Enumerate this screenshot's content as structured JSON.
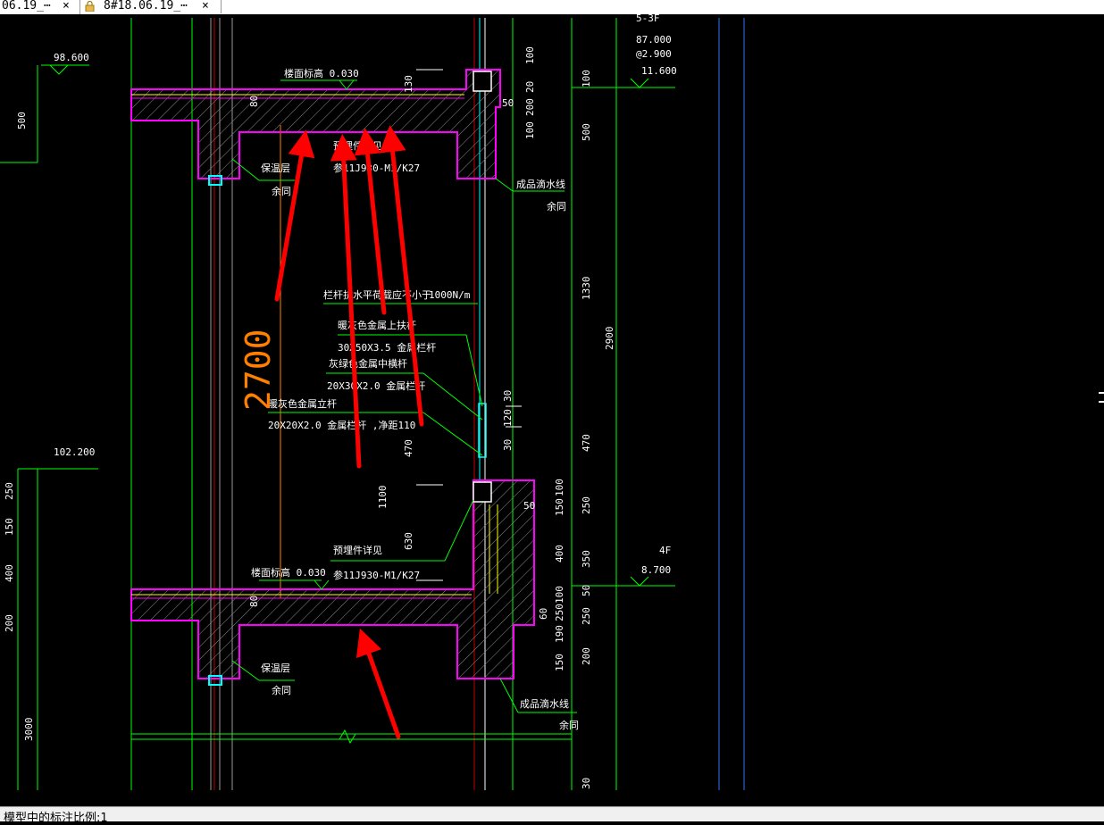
{
  "tabs": [
    {
      "label": "06.19_⋯",
      "close": "×"
    },
    {
      "label": "8#18.06.19_⋯",
      "close": "×"
    }
  ],
  "status": {
    "text": "模型中的标注比例:1"
  },
  "colors": {
    "background": "#000000",
    "green": "#00ff00",
    "magenta": "#ff00ff",
    "white": "#ffffff",
    "red": "#ff0000",
    "cyan": "#00ffff",
    "orange": "#ff7f00"
  },
  "drawing": {
    "left_levels": {
      "top": "98.600",
      "bottom": "102.200"
    },
    "left_dims": [
      "500",
      "250",
      "150",
      "400",
      "200",
      "3000"
    ],
    "floor_level_top": "楼面标高 0.030",
    "floor_level_bottom": "楼面标高 0.030",
    "embed_note_top": "预埋件详见",
    "embed_ref_top": "参11J930-M1/K27",
    "embed_note_bottom": "预埋件详见",
    "embed_ref_bottom": "参11J930-M1/K27",
    "insulation": "保温层",
    "same": "余同",
    "drip_line": "成品滴水线",
    "railing_load": "栏杆抗水平荷载应不小于",
    "railing_load_value": "1000N/m",
    "top_rail_label": "暖灰色金属上扶杆",
    "top_rail_spec": "30X50X3.5  金属栏杆",
    "mid_rail_label": "灰绿色金属中横杆",
    "mid_rail_spec": "20X30X2.0  金属栏杆",
    "post_label": "暖灰色金属立杆",
    "post_spec": "20X20X2.0  金属栏杆 ,净距110",
    "big_dim": "2700",
    "mid_dims": [
      "130",
      "470",
      "1100",
      "630",
      "80",
      "80"
    ],
    "right_dims": [
      "100",
      "200",
      "20",
      "100",
      "50",
      "30",
      "120",
      "30",
      "100",
      "150",
      "50",
      "250",
      "400",
      "100",
      "60",
      "250",
      "190",
      "150",
      "200",
      "350"
    ],
    "far_dims": [
      "100",
      "500",
      "1330",
      "2900",
      "470",
      "250",
      "350",
      "50",
      "250",
      "200",
      "30"
    ],
    "right_levels": {
      "header": "5-3F",
      "v1": "87.000",
      "v2": "@2.900",
      "v3": "11.600",
      "floor": "4F",
      "v4": "8.700"
    }
  }
}
